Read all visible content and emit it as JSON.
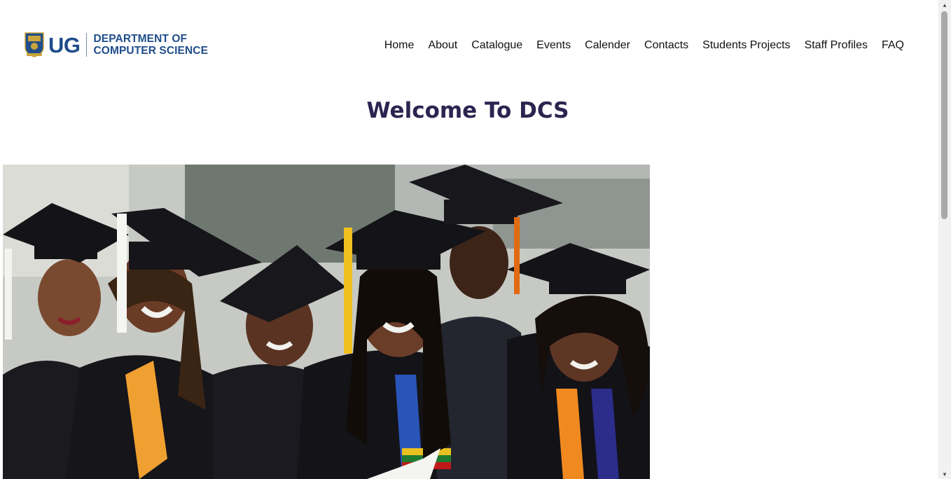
{
  "logo": {
    "short": "UG",
    "dept_line1": "DEPARTMENT OF",
    "dept_line2": "COMPUTER SCIENCE"
  },
  "nav": {
    "items": [
      {
        "label": "Home"
      },
      {
        "label": "About"
      },
      {
        "label": "Catalogue"
      },
      {
        "label": "Events"
      },
      {
        "label": "Calender"
      },
      {
        "label": "Contacts"
      },
      {
        "label": "Students Projects"
      },
      {
        "label": "Staff Profiles"
      },
      {
        "label": "FAQ"
      }
    ]
  },
  "main": {
    "heading": "Welcome To DCS"
  },
  "colors": {
    "brand_blue": "#1f4d8a",
    "heading": "#2a2550",
    "nav_text": "#111111"
  },
  "icons": {
    "crest": "university-crest-icon",
    "scroll_up": "scroll-up-arrow-icon",
    "scroll_down": "scroll-down-arrow-icon"
  }
}
